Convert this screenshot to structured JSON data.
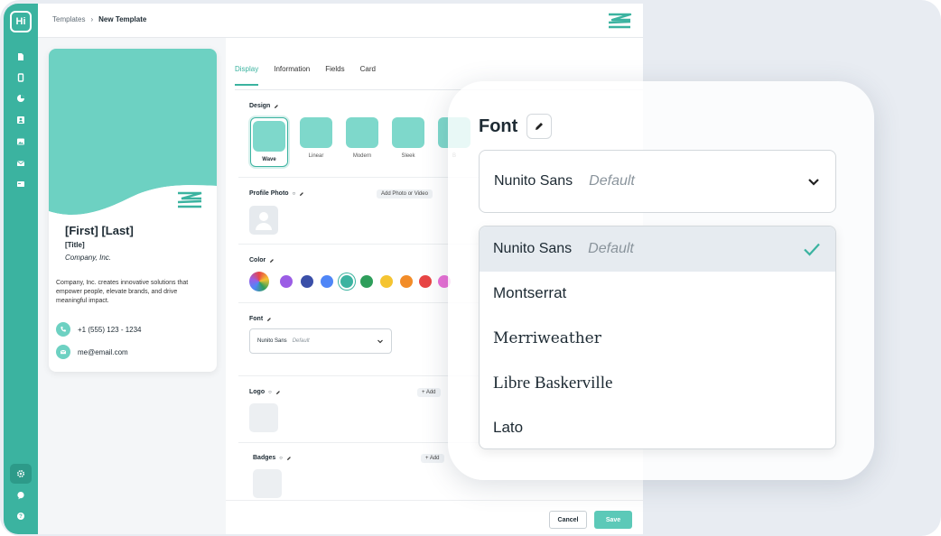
{
  "app": {
    "logo_text": "Hi",
    "accent_color": "#3bb3a0"
  },
  "sidebar": {
    "icons": [
      "document-icon",
      "phone-icon",
      "pie-chart-icon",
      "contact-card-icon",
      "image-icon",
      "mail-icon",
      "card-icon"
    ],
    "bottom_icons": [
      "settings-icon",
      "chat-icon",
      "help-icon"
    ]
  },
  "header": {
    "breadcrumb_parent": "Templates",
    "breadcrumb_sep": "›",
    "breadcrumb_current": "New Template"
  },
  "preview": {
    "name": "[First] [Last]",
    "title": "[Title]",
    "company": "Company, Inc.",
    "bio": "Company, Inc. creates innovative solutions that empower people, elevate brands, and drive meaningful impact.",
    "phone": "+1 (555) 123 - 1234",
    "email": "me@email.com"
  },
  "editor": {
    "tabs": [
      {
        "label": "Display",
        "active": true
      },
      {
        "label": "Information",
        "active": false
      },
      {
        "label": "Fields",
        "active": false
      },
      {
        "label": "Card",
        "active": false
      }
    ],
    "design_label": "Design",
    "designs": [
      {
        "label": "Wave",
        "selected": true
      },
      {
        "label": "Linear",
        "selected": false
      },
      {
        "label": "Modern",
        "selected": false
      },
      {
        "label": "Sleek",
        "selected": false
      },
      {
        "label": "B",
        "selected": false
      }
    ],
    "profile_photo_label": "Profile Photo",
    "add_photo_label": "Add Photo or Video",
    "color_label": "Color",
    "colors": [
      "#9b5de5",
      "#3a4fa8",
      "#4f86f7",
      "#3bb3a0",
      "#2e9e5b",
      "#f5c431",
      "#f28c28",
      "#e84545",
      "#e96fd6"
    ],
    "font_label": "Font",
    "font_value": "Nunito Sans",
    "font_default": "Default",
    "logo_label": "Logo",
    "add_label": "+ Add",
    "badges_label": "Badges",
    "cancel_label": "Cancel",
    "save_label": "Save"
  },
  "zoom": {
    "title": "Font",
    "selected_font": "Nunito Sans",
    "default_tag": "Default",
    "options": [
      {
        "label": "Nunito Sans",
        "tag": "Default",
        "selected": true
      },
      {
        "label": "Montserrat",
        "tag": "",
        "selected": false
      },
      {
        "label": "Merriweather",
        "tag": "",
        "selected": false
      },
      {
        "label": "Libre Baskerville",
        "tag": "",
        "selected": false
      },
      {
        "label": "Lato",
        "tag": "",
        "selected": false
      }
    ]
  }
}
